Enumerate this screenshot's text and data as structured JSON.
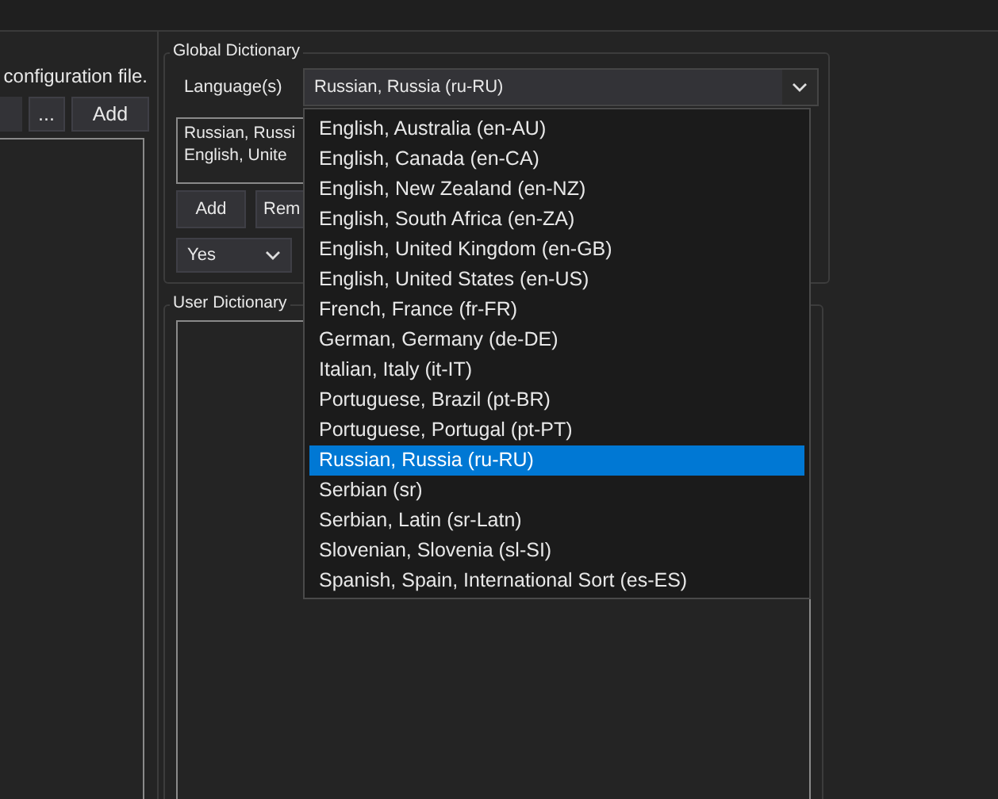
{
  "left_panel": {
    "hint": "configuration file.",
    "browse_button": "...",
    "add_button": "Add"
  },
  "global_dictionary": {
    "title": "Global Dictionary",
    "language_label": "Language(s)",
    "language_value": "Russian, Russia (ru-RU)",
    "languages_list": [
      "Russian, Russi",
      "English, Unite"
    ],
    "add_button": "Add",
    "remove_button": "Rem",
    "option_value": "Yes"
  },
  "user_dictionary": {
    "title": "User Dictionary"
  },
  "dropdown": [
    {
      "label": "English, Australia (en-AU)",
      "selected": false
    },
    {
      "label": "English, Canada (en-CA)",
      "selected": false
    },
    {
      "label": "English, New Zealand (en-NZ)",
      "selected": false
    },
    {
      "label": "English, South Africa (en-ZA)",
      "selected": false
    },
    {
      "label": "English, United Kingdom (en-GB)",
      "selected": false
    },
    {
      "label": "English, United States (en-US)",
      "selected": false
    },
    {
      "label": "French, France (fr-FR)",
      "selected": false
    },
    {
      "label": "German, Germany (de-DE)",
      "selected": false
    },
    {
      "label": "Italian, Italy (it-IT)",
      "selected": false
    },
    {
      "label": "Portuguese, Brazil (pt-BR)",
      "selected": false
    },
    {
      "label": "Portuguese, Portugal (pt-PT)",
      "selected": false
    },
    {
      "label": "Russian, Russia (ru-RU)",
      "selected": true
    },
    {
      "label": "Serbian (sr)",
      "selected": false
    },
    {
      "label": "Serbian, Latin (sr-Latn)",
      "selected": false
    },
    {
      "label": "Slovenian, Slovenia (sl-SI)",
      "selected": false
    },
    {
      "label": "Spanish, Spain, International Sort (es-ES)",
      "selected": false
    }
  ]
}
